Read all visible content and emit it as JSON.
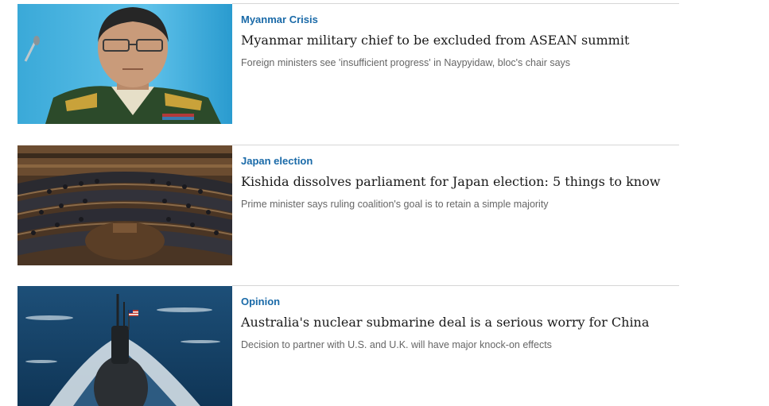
{
  "stories": [
    {
      "kicker": "Myanmar Crisis",
      "headline": "Myanmar military chief to be excluded from ASEAN summit",
      "summary": "Foreign ministers see 'insufficient progress' in Naypyidaw, bloc's chair says"
    },
    {
      "kicker": "Japan election",
      "headline": "Kishida dissolves parliament for Japan election: 5 things to know",
      "summary": "Prime minister says ruling coalition's goal is to retain a simple majority"
    },
    {
      "kicker": "Opinion",
      "headline": "Australia's nuclear submarine deal is a serious worry for China",
      "summary": "Decision to partner with U.S. and U.K. will have major knock-on effects"
    }
  ],
  "colors": {
    "kicker": "#1a6aa8",
    "headline": "#1a1a1a",
    "summary": "#666666",
    "rule": "#d6d6d6"
  }
}
